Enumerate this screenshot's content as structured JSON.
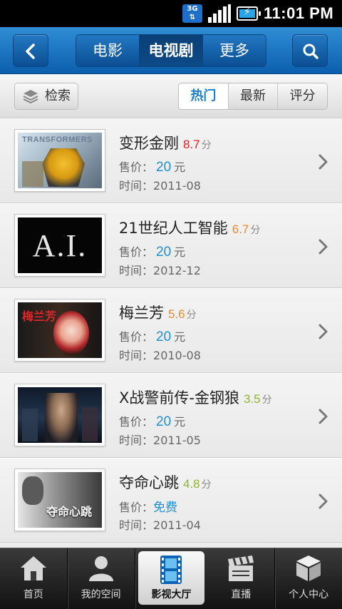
{
  "status_bar": {
    "network": "3G",
    "time": "11:01 PM"
  },
  "header": {
    "tabs": [
      {
        "label": "电影"
      },
      {
        "label": "电视剧"
      },
      {
        "label": "更多"
      }
    ],
    "active_tab": "电视剧"
  },
  "filter_bar": {
    "filter_label": "检索",
    "sort_tabs": [
      {
        "label": "热门"
      },
      {
        "label": "最新"
      },
      {
        "label": "评分"
      }
    ],
    "active_sort": "热门"
  },
  "list": {
    "price_prefix": "售价：",
    "time_prefix": "时间：",
    "score_unit": "分",
    "currency_unit": "元",
    "items": [
      {
        "title": "变形金刚",
        "score": "8.7",
        "score_color": "#e02020",
        "price": "20",
        "date": "2011-08",
        "poster_text": "TRANSFORMERS"
      },
      {
        "title": "21世纪人工智能",
        "score": "6.7",
        "score_color": "#f0882a",
        "price": "20",
        "date": "2012-12",
        "poster_text": "A.I."
      },
      {
        "title": "梅兰芳",
        "score": "5.6",
        "score_color": "#f0882a",
        "price": "20",
        "date": "2010-08",
        "poster_text": "梅兰芳"
      },
      {
        "title": "X战警前传-金钢狼",
        "score": "3.5",
        "score_color": "#8ab82a",
        "price": "20",
        "date": "2011-05",
        "poster_text": ""
      },
      {
        "title": "夺命心跳",
        "score": "4.8",
        "score_color": "#8ab82a",
        "price": "免费",
        "date": "2011-04",
        "poster_text": "夺命心跳"
      }
    ]
  },
  "bottom_nav": {
    "tabs": [
      {
        "label": "首页",
        "icon": "home-icon"
      },
      {
        "label": "我的空间",
        "icon": "user-icon"
      },
      {
        "label": "影视大厅",
        "icon": "film-icon"
      },
      {
        "label": "直播",
        "icon": "clapperboard-icon"
      },
      {
        "label": "个人中心",
        "icon": "cube-icon"
      }
    ],
    "active_tab": "影视大厅"
  }
}
